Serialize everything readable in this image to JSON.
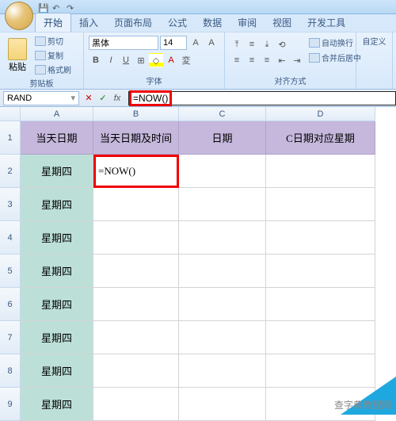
{
  "tabs": [
    "开始",
    "插入",
    "页面布局",
    "公式",
    "数据",
    "审阅",
    "视图",
    "开发工具"
  ],
  "active_tab": 0,
  "clipboard": {
    "paste": "粘贴",
    "cut": "剪切",
    "copy": "复制",
    "format": "格式刷",
    "label": "剪贴板"
  },
  "font": {
    "name": "黑体",
    "size": "14",
    "label": "字体"
  },
  "align": {
    "wrap": "自动换行",
    "merge": "合并后居中",
    "label": "对齐方式"
  },
  "custom_btn": "自定义",
  "namebox": "RAND",
  "formula": "=NOW()",
  "columns": [
    "A",
    "B",
    "C",
    "D"
  ],
  "rows": [
    "1",
    "2",
    "3",
    "4",
    "5",
    "6",
    "7",
    "8",
    "9"
  ],
  "headers": {
    "A": "当天日期",
    "B": "当天日期及时间",
    "C": "日期",
    "D": "C日期对应星期"
  },
  "colA_data": [
    "星期四",
    "星期四",
    "星期四",
    "星期四",
    "星期四",
    "星期四",
    "星期四",
    "星期四"
  ],
  "b2": "=NOW()",
  "watermark": "查字典教程网"
}
